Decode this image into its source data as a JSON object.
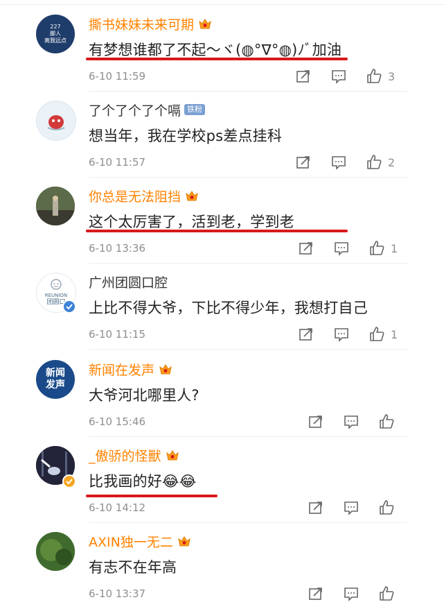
{
  "comments": [
    {
      "name": "撕书妹妹未来可期",
      "name_style": "vip",
      "badge": "crown",
      "avatar": {
        "type": "text",
        "lines": [
          "227",
          "脚人",
          "离我远点"
        ],
        "bg": "#1f3d6b"
      },
      "text": "有梦想谁都了不起～ヾ(◍°∇°◍)ﾉﾞ加油",
      "underlined": true,
      "time": "6-10 11:59",
      "likes": "3"
    },
    {
      "name": "了个了个了个嗝",
      "name_style": "normal",
      "badge": "fan",
      "fan_label": "铁粉",
      "avatar": {
        "type": "art",
        "bg": "#eaf2f8"
      },
      "text": "想当年，我在学校ps差点挂科",
      "underlined": false,
      "time": "6-10 11:57",
      "likes": "2"
    },
    {
      "name": "你总是无法阻挡",
      "name_style": "vip",
      "badge": "crown",
      "avatar": {
        "type": "photo",
        "bg": "#4b5540"
      },
      "text": "这个太厉害了，活到老，学到老",
      "underlined": true,
      "time": "6-10 13:36",
      "likes": "1"
    },
    {
      "name": "广州团圆口腔",
      "name_style": "normal",
      "badge": "none",
      "avatar": {
        "type": "logo",
        "lines": [
          "REUNION",
          "团圆口"
        ],
        "bg": "#ffffff"
      },
      "text": "上比不得大爷，下比不得少年，我想打自己",
      "underlined": false,
      "time": "6-10 11:15",
      "likes": "1"
    },
    {
      "name": "新闻在发声",
      "name_style": "vip",
      "badge": "crown",
      "avatar": {
        "type": "text",
        "lines": [
          "新闻",
          "发声"
        ],
        "bg": "#1a4a8a"
      },
      "text": "大爷河北哪里人?",
      "underlined": false,
      "time": "6-10 15:46",
      "likes": ""
    },
    {
      "name": "_傲骄的怪獸",
      "name_style": "vip",
      "badge": "crown",
      "avatar": {
        "type": "photo",
        "bg": "#2a2a3c"
      },
      "text": "比我画的好",
      "emoji_suffix": "😂😂",
      "underlined": true,
      "time": "6-10 14:12",
      "likes": ""
    },
    {
      "name": "AXIN独一无二",
      "name_style": "vip",
      "badge": "crown",
      "avatar": {
        "type": "photo",
        "bg": "#3f6b2e"
      },
      "text": "有志不在年高",
      "underlined": false,
      "time": "6-10 13:37",
      "likes": ""
    }
  ],
  "colors": {
    "vip_name": "#ff8200",
    "underline": "#d8191b",
    "meta": "#8e8e8e"
  }
}
